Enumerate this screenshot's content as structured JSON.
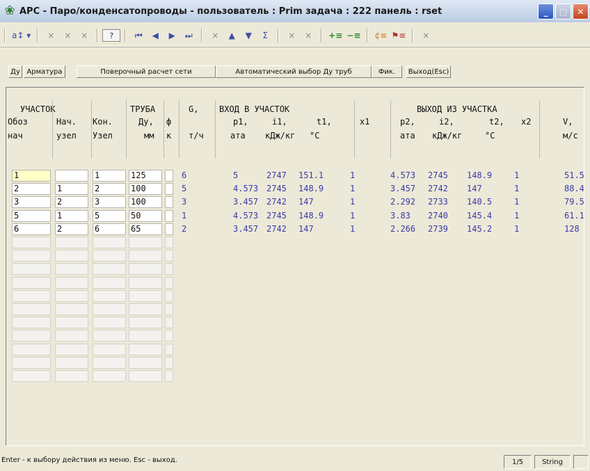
{
  "window": {
    "title": "APC - Паро/конденсатопроводы -   пользователь : Prim  задача : 222  панель : rset"
  },
  "toolbar": {
    "buttons": [
      {
        "name": "sort-icon",
        "glyph": "a↕ ▾"
      },
      {
        "name": "close-x-icon",
        "glyph": "×"
      },
      {
        "name": "close-x-icon",
        "glyph": "×"
      },
      {
        "name": "close-x-icon",
        "glyph": "×"
      },
      {
        "name": "help-icon",
        "glyph": "?"
      },
      {
        "name": "first-record-icon",
        "glyph": "⏮"
      },
      {
        "name": "prev-record-icon",
        "glyph": "◀"
      },
      {
        "name": "next-record-icon",
        "glyph": "▶"
      },
      {
        "name": "last-record-icon",
        "glyph": "⏭"
      },
      {
        "name": "close-x-icon",
        "glyph": "×"
      },
      {
        "name": "move-up-icon",
        "glyph": "▲"
      },
      {
        "name": "move-down-icon",
        "glyph": "▼"
      },
      {
        "name": "sum-icon",
        "glyph": "Σ"
      },
      {
        "name": "close-x-icon",
        "glyph": "×"
      },
      {
        "name": "close-x-icon",
        "glyph": "×"
      },
      {
        "name": "insert-row-icon",
        "glyph": "+≡"
      },
      {
        "name": "delete-row-icon",
        "glyph": "−≡"
      },
      {
        "name": "color-icon",
        "glyph": "¢≡"
      },
      {
        "name": "tool-icon",
        "glyph": "⚑≡"
      },
      {
        "name": "close-x-icon",
        "glyph": "×"
      }
    ]
  },
  "menu": {
    "items": [
      "Ду",
      "Арматура",
      "Поверочный расчет сети",
      "Автоматический выбор Ду труб",
      "Фик.",
      "Выход(Esc)"
    ]
  },
  "table": {
    "header": {
      "row1": {
        "uchastok": "УЧАСТОК",
        "truba": "ТРУБА",
        "g": "G,",
        "vhod": "ВХОД В УЧАСТОК",
        "vyhod": "ВЫХОД ИЗ УЧАСТКА"
      },
      "row2": {
        "oboz": "Обоз",
        "nach": "Нач.",
        "kon": "Кон.",
        "du": "Ду,",
        "f": "ф",
        "p1": "p1,",
        "i1": "i1,",
        "t1": "t1,",
        "x1": "x1",
        "p2": "p2,",
        "i2": "i2,",
        "t2": "t2,",
        "x2": "x2",
        "v": "V,"
      },
      "row3": {
        "oboz": "нач",
        "nach": "узел",
        "kon": "Узел",
        "du": "мм",
        "f": "к",
        "g": "т/ч",
        "p1": "ата",
        "i1": "кДж/кг",
        "t1": "°С",
        "p2": "ата",
        "i2": "кДж/кг",
        "t2": "°С",
        "v": "м/с"
      }
    },
    "rows": [
      {
        "oboz": "1",
        "nach": "",
        "kon": "1",
        "du": "125",
        "g": "6",
        "p1": "5",
        "i1": "2747",
        "t1": "151.1",
        "x1": "1",
        "p2": "4.573",
        "i2": "2745",
        "t2": "148.9",
        "x2": "1",
        "v": "51.5"
      },
      {
        "oboz": "2",
        "nach": "1",
        "kon": "2",
        "du": "100",
        "g": "5",
        "p1": "4.573",
        "i1": "2745",
        "t1": "148.9",
        "x1": "1",
        "p2": "3.457",
        "i2": "2742",
        "t2": "147",
        "x2": "1",
        "v": "88.4"
      },
      {
        "oboz": "3",
        "nach": "2",
        "kon": "3",
        "du": "100",
        "g": "3",
        "p1": "3.457",
        "i1": "2742",
        "t1": "147",
        "x1": "1",
        "p2": "2.292",
        "i2": "2733",
        "t2": "140.5",
        "x2": "1",
        "v": "79.5"
      },
      {
        "oboz": "5",
        "nach": "1",
        "kon": "5",
        "du": "50",
        "g": "1",
        "p1": "4.573",
        "i1": "2745",
        "t1": "148.9",
        "x1": "1",
        "p2": "3.83",
        "i2": "2740",
        "t2": "145.4",
        "x2": "1",
        "v": "61.1"
      },
      {
        "oboz": "6",
        "nach": "2",
        "kon": "6",
        "du": "65",
        "g": "2",
        "p1": "3.457",
        "i1": "2742",
        "t1": "147",
        "x1": "1",
        "p2": "2.266",
        "i2": "2739",
        "t2": "145.2",
        "x2": "1",
        "v": "128"
      }
    ]
  },
  "status": {
    "text": "Enter - к выбору действия из меню.  Esc - выход.",
    "page": "1/5",
    "type": "String"
  }
}
